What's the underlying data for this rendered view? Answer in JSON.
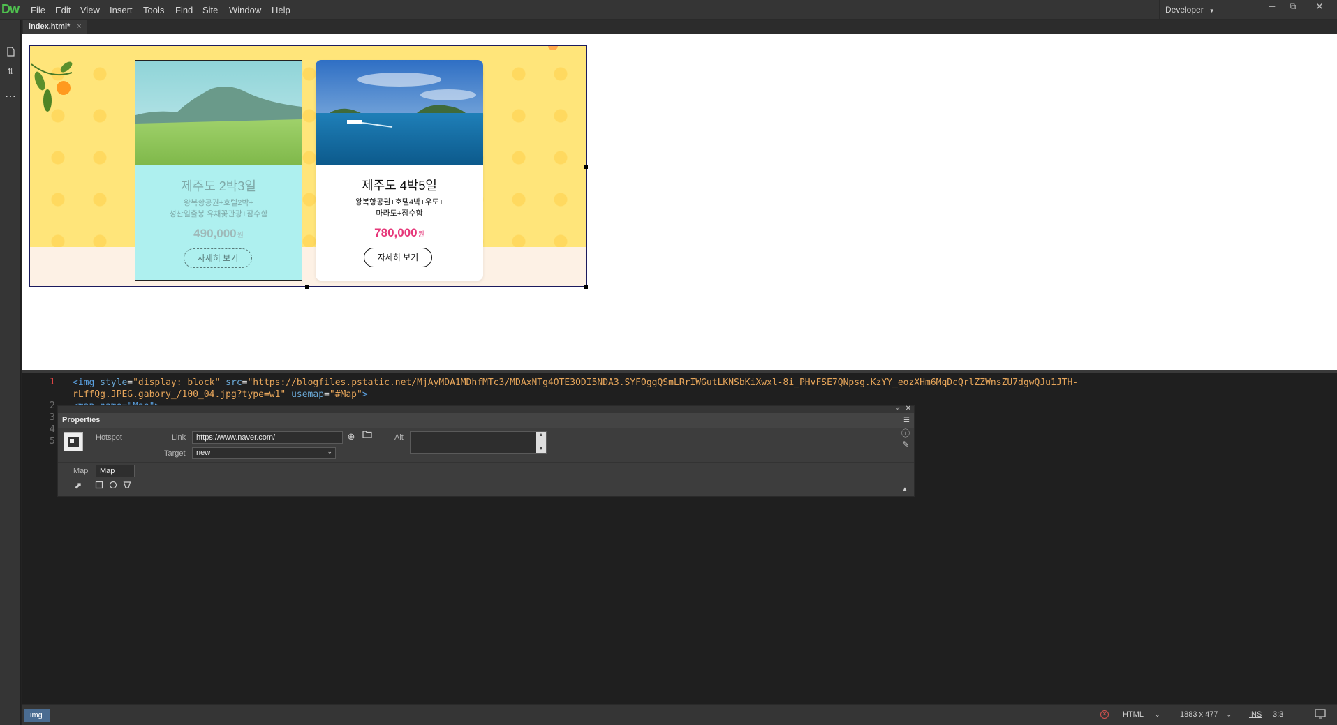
{
  "app": {
    "logo": "Dw"
  },
  "menu": [
    "File",
    "Edit",
    "View",
    "Insert",
    "Tools",
    "Find",
    "Site",
    "Window",
    "Help"
  ],
  "workspace": {
    "label": "Developer"
  },
  "document": {
    "tab_label": "index.html*",
    "close_glyph": "×"
  },
  "cards": [
    {
      "title": "제주도 2박3일",
      "desc_line1": "왕복항공권+호텔2박+",
      "desc_line2": "성산일출봉 유채꽃관광+잠수함",
      "price": "490,000",
      "price_unit": "원",
      "button": "자세히 보기"
    },
    {
      "title": "제주도 4박5일",
      "desc_line1": "왕복항공권+호텔4박+우도+",
      "desc_line2": "마라도+잠수함",
      "price": "780,000",
      "price_unit": "원",
      "button": "자세히 보기"
    }
  ],
  "code": {
    "line_numbers": [
      "1",
      "2",
      "3",
      "4",
      "5"
    ],
    "line1_tag": "<img",
    "line1_style_attr": "style",
    "line1_style_val": "\"display: block\"",
    "line1_src_attr": "src",
    "line1_src_val_a": "\"https://blogfiles.pstatic.net/MjAyMDA1MDhfMTc3/MDAxNTg4OTE3ODI5NDA3.SYFOggQSmLRrIWGutLKNSbKiXwxl-8i_PHvFSE7QNpsg.KzYY_eozXHm6MqDcQrlZZWnsZU7dgwQJu1JTH-",
    "line1_src_val_b": "rLffQg.JPEG.gabory_/100_04.jpg?type=w1\"",
    "line1_usemap_attr": "usemap",
    "line1_usemap_val": "\"#Map\"",
    "line1_close": ">",
    "line2_partial": "<map name=\"Map\">"
  },
  "properties": {
    "title": "Properties",
    "type_label": "Hotspot",
    "link_label": "Link",
    "link_value": "https://www.naver.com/",
    "target_label": "Target",
    "target_value": "new",
    "alt_label": "Alt",
    "map_label": "Map",
    "map_value": "Map"
  },
  "statusbar": {
    "tag": "img",
    "doc_type": "HTML",
    "dimensions": "1883 x 477",
    "mode": "INS",
    "position": "3:3"
  },
  "colors": {
    "accent_logo": "#4fc14f",
    "banner_bg": "#ffe57a",
    "card1_bg": "#aef0ef",
    "price_pink": "#e6387a"
  }
}
